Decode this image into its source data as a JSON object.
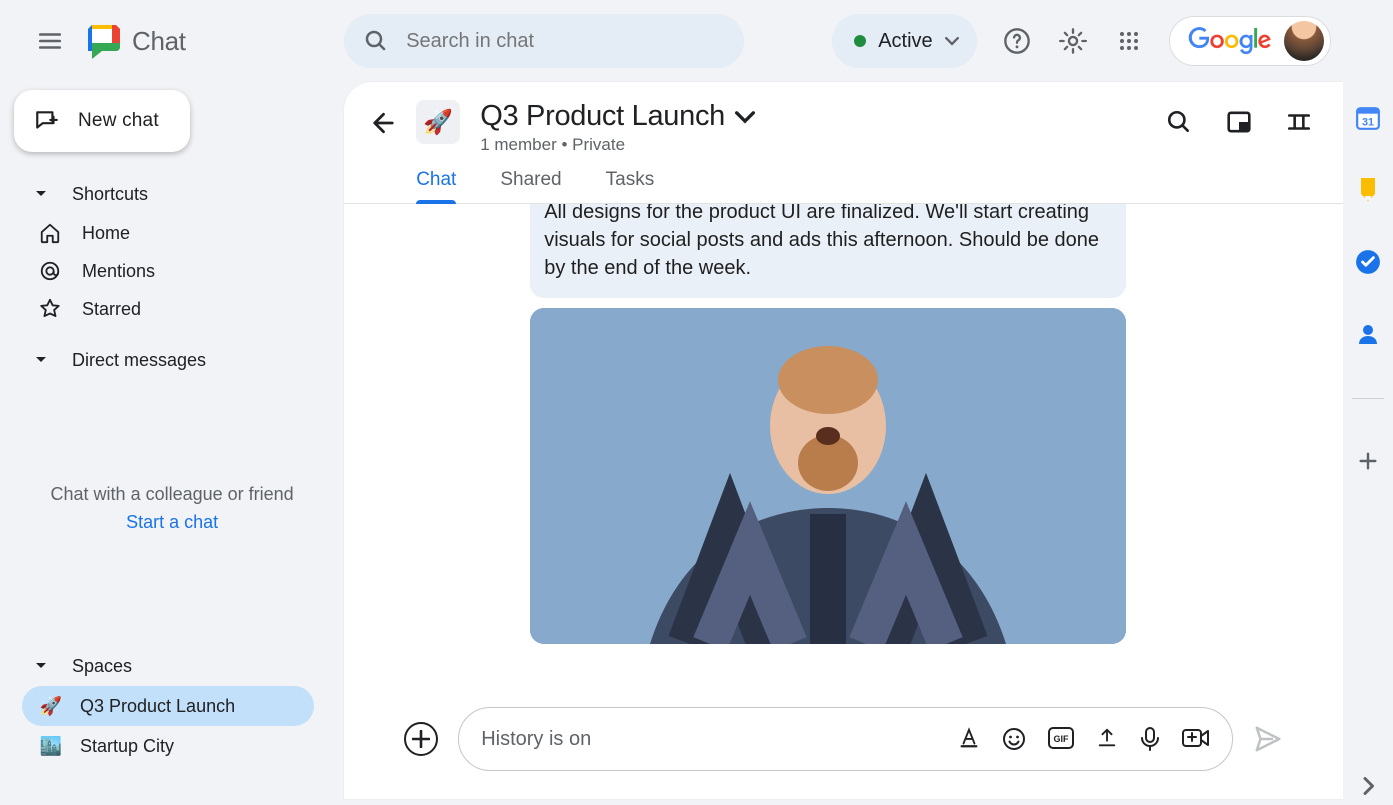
{
  "app": {
    "name": "Chat"
  },
  "header": {
    "search_placeholder": "Search in chat",
    "status": "Active",
    "google_label": "Google"
  },
  "sidebar": {
    "new_chat": "New chat",
    "shortcuts_label": "Shortcuts",
    "home": "Home",
    "mentions": "Mentions",
    "starred": "Starred",
    "direct_messages": "Direct messages",
    "dm_hint": "Chat with a colleague or friend",
    "dm_cta": "Start a chat",
    "spaces_label": "Spaces",
    "spaces": [
      {
        "icon": "🚀",
        "label": "Q3 Product Launch"
      },
      {
        "icon": "🏙️",
        "label": "Startup City"
      }
    ]
  },
  "room": {
    "icon": "🚀",
    "title": "Q3 Product Launch",
    "subtitle": "1 member  •  Private",
    "tabs": [
      "Chat",
      "Shared",
      "Tasks"
    ],
    "active_tab": 0
  },
  "messages": {
    "text": "All designs for the product UI are finalized. We'll start creating visuals for social posts and ads this afternoon. Should be done by the end of the week."
  },
  "composer": {
    "placeholder": "History is on"
  }
}
